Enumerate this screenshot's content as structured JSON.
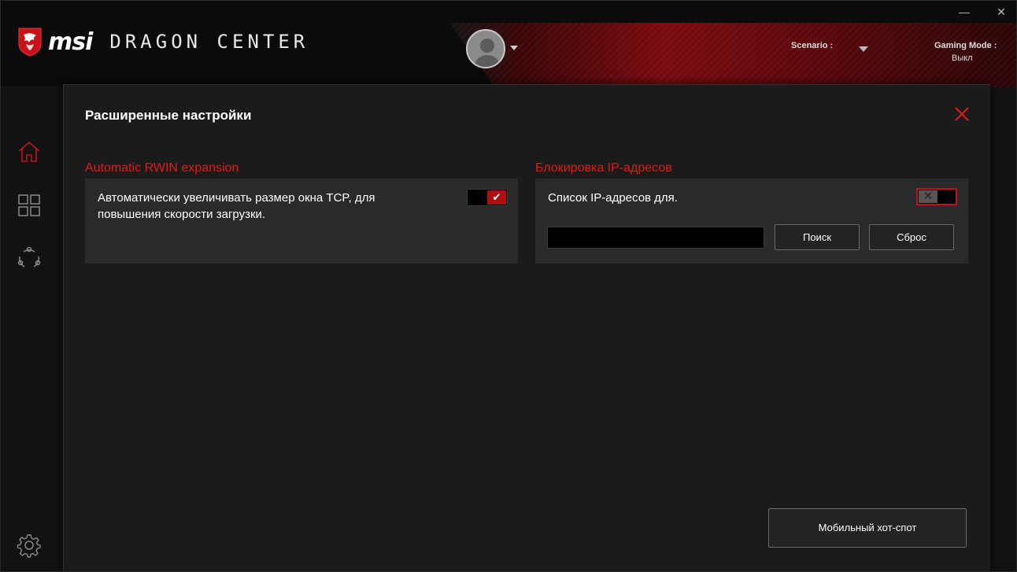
{
  "app": {
    "brand": "msi",
    "product": "DRAGON CENTER"
  },
  "window_controls": {
    "minimize": "—",
    "close": "✕"
  },
  "header": {
    "scenario_label": "Scenario :",
    "gaming_mode_label": "Gaming Mode :",
    "gaming_mode_value": "Выкл"
  },
  "sidebar": {
    "items": [
      {
        "icon": "home-icon",
        "active": true
      },
      {
        "icon": "apps-grid-icon",
        "active": false
      },
      {
        "icon": "network-icon",
        "active": false
      }
    ],
    "settings_icon": "gear-icon"
  },
  "modal": {
    "title": "Расширенные настройки",
    "rwin": {
      "label": "Automatic RWIN expansion",
      "description_line1": "Автоматически увеличивать размер окна TCP, для",
      "description_line2": "повышения скорости загрузки.",
      "toggle_state": "on",
      "toggle_glyph": "✔"
    },
    "ip_block": {
      "label": "Блокировка IP-адресов",
      "description": "Список IP-адресов для.",
      "toggle_state": "off",
      "toggle_glyph": "✕",
      "input_value": "",
      "search_button": "Поиск",
      "reset_button": "Сброс"
    },
    "hotspot_button": "Мобильный хот-спот"
  },
  "colors": {
    "accent": "#e01b1b",
    "toggle_on": "#b00d12",
    "background": "#1b1b1b",
    "card": "#2a2a2a"
  }
}
